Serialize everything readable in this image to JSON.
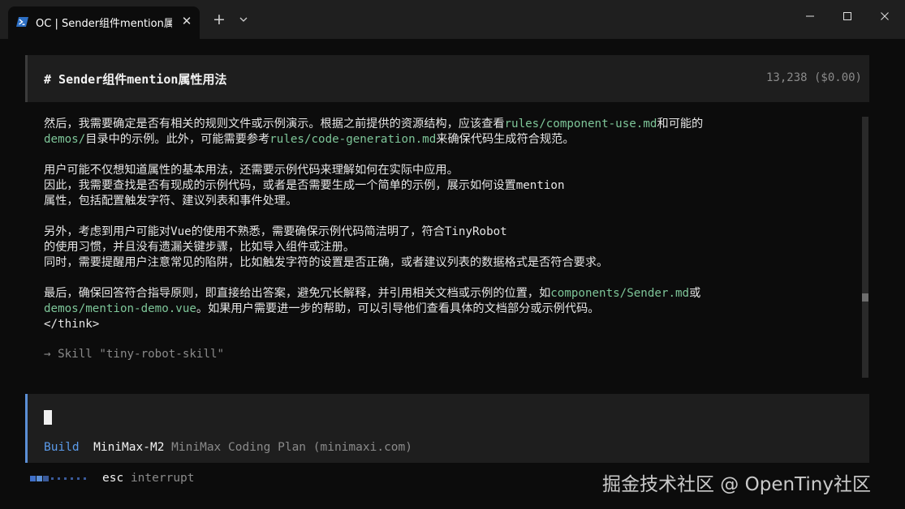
{
  "window": {
    "tab_title": "OC | Sender组件mention属性用",
    "tab_close_icon": "close-icon",
    "new_tab_glyph": "+",
    "dropdown_glyph": "⌄",
    "minimize_glyph": "—",
    "maximize_glyph": "☐",
    "close_glyph": "✕"
  },
  "header": {
    "title": "# Sender组件mention属性用法",
    "stats": "13,238 ($0.00)"
  },
  "body": {
    "lines": [
      [
        {
          "t": "然后，我需要确定是否有相关的规则文件或示例演示。根据之前提供的资源结构，应该查看"
        },
        {
          "t": "rules/component-use.md",
          "code": true
        },
        {
          "t": "和可能的"
        }
      ],
      [
        {
          "t": "demos/",
          "code": true
        },
        {
          "t": "目录中的示例。此外，可能需要参考"
        },
        {
          "t": "rules/code-generation.md",
          "code": true
        },
        {
          "t": "来确保代码生成符合规范。"
        }
      ],
      [],
      [
        {
          "t": "用户可能不仅想知道属性的基本用法，还需要示例代码来理解如何在实际中应用。"
        }
      ],
      [
        {
          "t": "因此，我需要查找是否有现成的示例代码，或者是否需要生成一个简单的示例，展示如何设置mention"
        }
      ],
      [
        {
          "t": "属性，包括配置触发字符、建议列表和事件处理。"
        }
      ],
      [],
      [
        {
          "t": "另外，考虑到用户可能对Vue的使用不熟悉，需要确保示例代码简洁明了，符合TinyRobot"
        }
      ],
      [
        {
          "t": "的使用习惯，并且没有遗漏关键步骤，比如导入组件或注册。"
        }
      ],
      [
        {
          "t": "同时，需要提醒用户注意常见的陷阱，比如触发字符的设置是否正确，或者建议列表的数据格式是否符合要求。"
        }
      ],
      [],
      [
        {
          "t": "最后，确保回答符合指导原则，即直接给出答案，避免冗长解释，并引用相关文档或示例的位置，如"
        },
        {
          "t": "components/Sender.md",
          "code": true
        },
        {
          "t": "或"
        }
      ],
      [
        {
          "t": "demos/mention-demo.vue",
          "code": true
        },
        {
          "t": "。如果用户需要进一步的帮助，可以引导他们查看具体的文档部分或示例代码。"
        }
      ],
      [
        {
          "t": "</think>"
        }
      ]
    ],
    "skill_line": "→ Skill \"tiny-robot-skill\""
  },
  "input": {
    "mode": "Build",
    "model": "MiniMax-M2",
    "provider": "MiniMax Coding Plan (minimaxi.com)"
  },
  "footer": {
    "key": "esc",
    "action": "interrupt",
    "watermark": "掘金技术社区 @ OpenTiny社区"
  },
  "colors": {
    "code": "#7ec699",
    "accent": "#5b9bea",
    "background": "#0c0c0c",
    "panel": "#1e1e1e"
  }
}
